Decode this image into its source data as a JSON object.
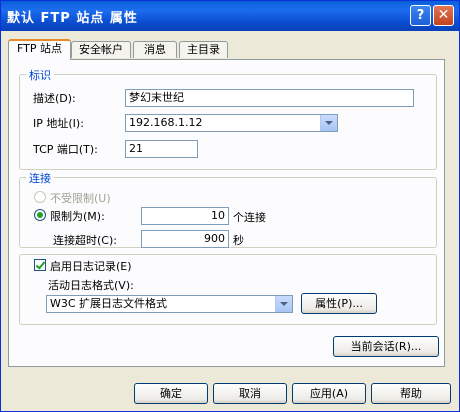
{
  "window": {
    "title": "默认 FTP 站点 属性",
    "help_glyph": "?",
    "close_glyph": "✕"
  },
  "tabs": [
    "FTP 站点",
    "安全帐户",
    "消息",
    "主目录"
  ],
  "identity_group": {
    "title": "标识",
    "description_label": "描述(D):",
    "description_value": "梦幻末世纪",
    "ip_label": "IP 地址(I):",
    "ip_value": "192.168.1.12",
    "port_label": "TCP 端口(T):",
    "port_value": "21"
  },
  "connection_group": {
    "title": "连接",
    "unlimited_label": "不受限制(U)",
    "limited_label": "限制为(M):",
    "limited_value": "10",
    "limited_unit": "个连接",
    "timeout_label": "连接超时(C):",
    "timeout_value": "900",
    "timeout_unit": "秒"
  },
  "logging": {
    "enable_label": "启用日志记录(E)",
    "format_label": "活动日志格式(V):",
    "format_value": "W3C 扩展日志文件格式",
    "properties_button": "属性(P)..."
  },
  "current_sessions_button": "当前会话(R)...",
  "footer": {
    "ok": "确定",
    "cancel": "取消",
    "apply": "应用(A)",
    "help": "帮助"
  }
}
